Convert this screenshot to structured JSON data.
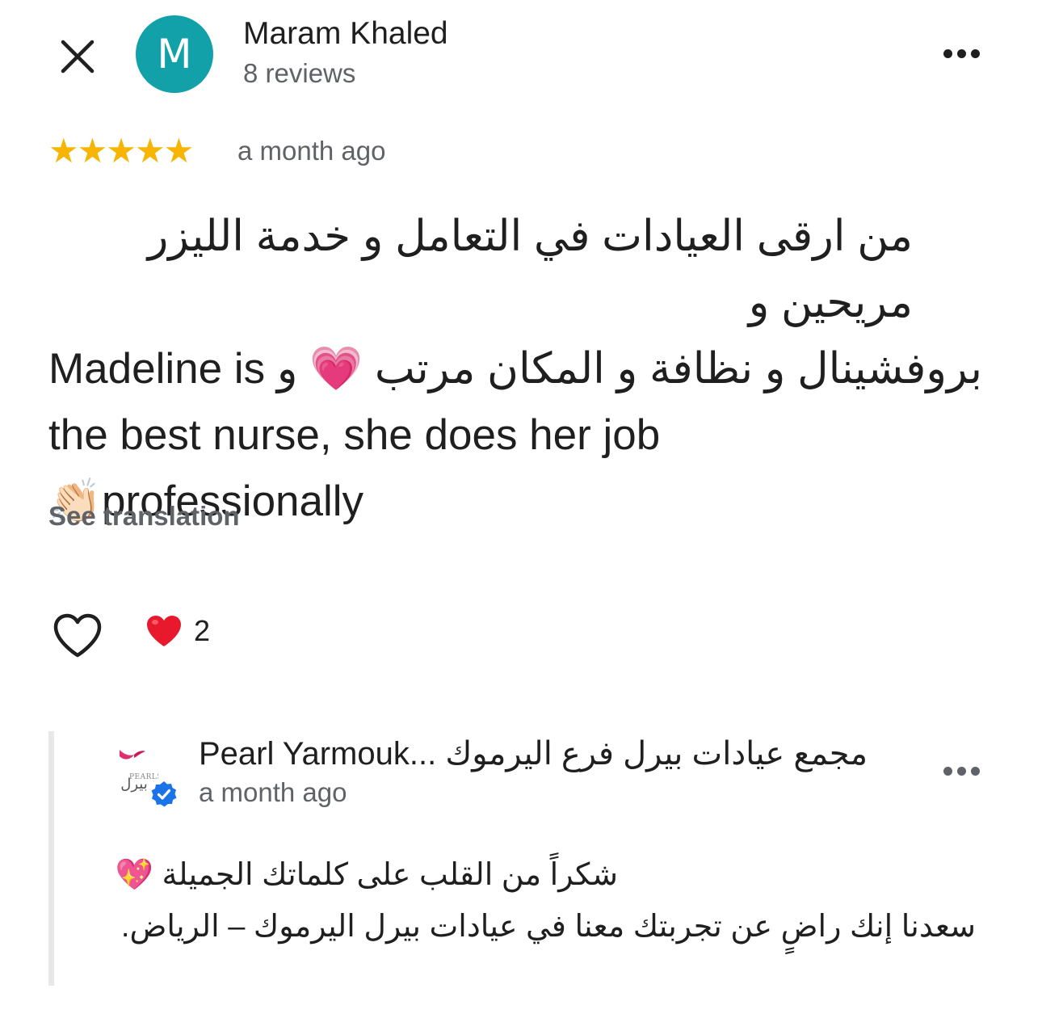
{
  "reviewer": {
    "avatar_letter": "M",
    "avatar_color": "#12a1a8",
    "name": "Maram Khaled",
    "review_count": "8 reviews"
  },
  "review": {
    "rating": 5,
    "stars": "★★★★★",
    "date": "a month ago",
    "text_line1": "من ارقى العيادات في التعامل و خدمة الليزر مريحين و",
    "text_line2_rtl": "بروفشينال و نظافة و المكان مرتب",
    "text_line2_emoji": "💗",
    "text_line2_waw": "و",
    "text_line2_ltr": "Madeline is",
    "text_line3": "the best nurse, she does her job",
    "text_line4_emoji": "👏🏻",
    "text_line4": "professionally",
    "see_translation": "See translation"
  },
  "reactions": {
    "like_icon": "heart-outline-icon",
    "reaction_emoji": "❤️",
    "count": "2"
  },
  "owner_reply": {
    "name": "Pearl Yarmouk... مجمع عيادات بيرل فرع اليرموك",
    "date": "a month ago",
    "logo_text": "PEARLS",
    "logo_text_ar": "بيرل",
    "line1": "شكراً من القلب على كلماتك الجميلة 💖",
    "line2": "سعدنا إنك راضٍ عن تجربتك معنا في عيادات بيرل اليرموك – الرياض."
  },
  "colors": {
    "star": "#f7b400",
    "muted_text": "#5f6368",
    "verified_badge": "#1a73e8",
    "logo_pink": "#e0306a"
  }
}
